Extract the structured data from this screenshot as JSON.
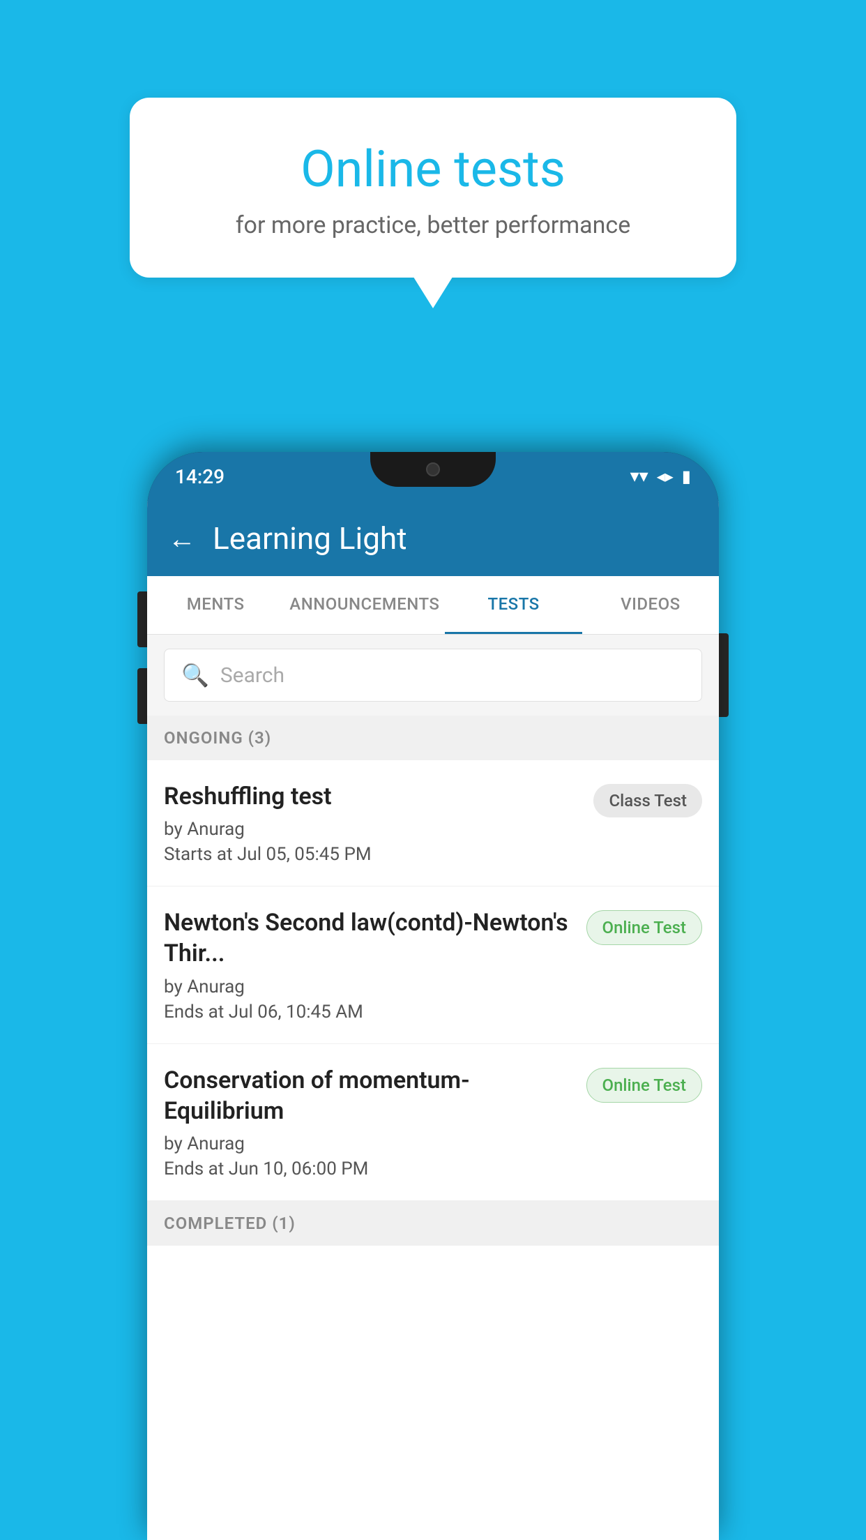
{
  "background": {
    "color": "#1ab8e8"
  },
  "speech_bubble": {
    "title": "Online tests",
    "subtitle": "for more practice, better performance"
  },
  "phone": {
    "status_bar": {
      "time": "14:29",
      "wifi_icon": "▾",
      "signal_icon": "▲",
      "battery_icon": "▮"
    },
    "app_header": {
      "back_label": "←",
      "title": "Learning Light"
    },
    "tabs": [
      {
        "label": "MENTS",
        "active": false
      },
      {
        "label": "ANNOUNCEMENTS",
        "active": false
      },
      {
        "label": "TESTS",
        "active": true
      },
      {
        "label": "VIDEOS",
        "active": false
      }
    ],
    "search": {
      "placeholder": "Search",
      "icon": "🔍"
    },
    "sections": [
      {
        "title": "ONGOING (3)",
        "tests": [
          {
            "name": "Reshuffling test",
            "author": "by Anurag",
            "time_label": "Starts at",
            "time": "Jul 05, 05:45 PM",
            "badge": "Class Test",
            "badge_type": "class"
          },
          {
            "name": "Newton's Second law(contd)-Newton's Thir...",
            "author": "by Anurag",
            "time_label": "Ends at",
            "time": "Jul 06, 10:45 AM",
            "badge": "Online Test",
            "badge_type": "online"
          },
          {
            "name": "Conservation of momentum-Equilibrium",
            "author": "by Anurag",
            "time_label": "Ends at",
            "time": "Jun 10, 06:00 PM",
            "badge": "Online Test",
            "badge_type": "online"
          }
        ]
      },
      {
        "title": "COMPLETED (1)",
        "tests": []
      }
    ]
  }
}
